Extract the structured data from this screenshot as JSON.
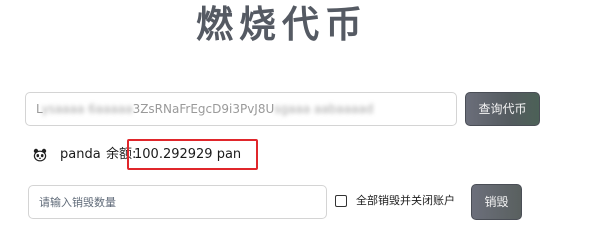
{
  "header": {
    "title": "燃烧代币"
  },
  "mint_field": {
    "value_visible_start": "L",
    "value_blurred_prefix": "ysaaaa 6aaaaa",
    "value_middle": "3ZsRNaFrEgcD9i3PvJ8U",
    "value_blurred_suffix": "sgaaa aabaaaad"
  },
  "query_button": {
    "label": "查询代币"
  },
  "account": {
    "icon": "panda-icon",
    "name": "panda",
    "balance_label": "余额:",
    "balance_value": "100.292929 pan",
    "highlight_color": "#e0262b"
  },
  "burn_amount_field": {
    "placeholder": "请输入销毁数量",
    "value": ""
  },
  "close_account_option": {
    "label": "全部销毁并关闭账户",
    "checked": false
  },
  "burn_button": {
    "label": "销毁"
  }
}
